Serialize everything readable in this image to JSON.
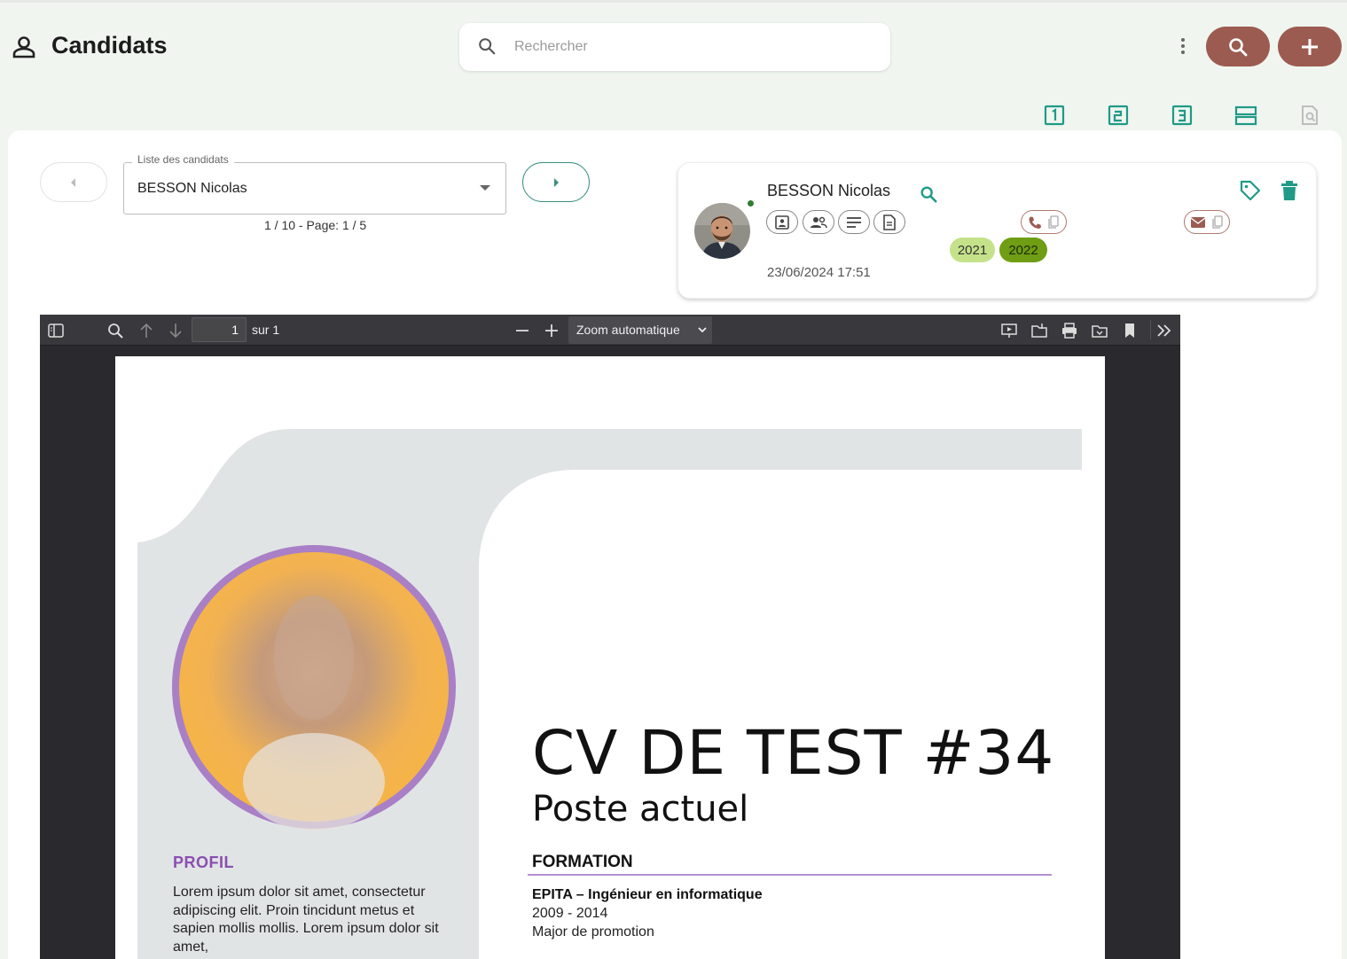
{
  "header": {
    "title": "Candidats",
    "search_placeholder": "Rechercher",
    "search_value": ""
  },
  "view_icons": [
    "view-1-icon",
    "view-2-icon",
    "view-3-icon",
    "split-view-icon",
    "document-search-icon"
  ],
  "selector": {
    "legend": "Liste des candidats",
    "selected": "BESSON Nicolas",
    "pager": "1 / 10 - Page: 1 / 5"
  },
  "candidate": {
    "name": "BESSON Nicolas",
    "date": "23/06/2024 17:51",
    "years": [
      "2021",
      "2022"
    ],
    "online": true
  },
  "pdf_viewer": {
    "page_number": "1",
    "page_of": "sur 1",
    "zoom": "Zoom automatique"
  },
  "cv": {
    "title": "CV DE TEST #34",
    "subtitle": "Poste actuel",
    "formation_heading": "FORMATION",
    "school": "EPITA – Ingénieur en informatique",
    "years": "2009 - 2014",
    "note": "Major de promotion",
    "profil_heading": "PROFIL",
    "profil_text": "Lorem ipsum dolor sit amet, consectetur adipiscing elit. Proin tincidunt metus et sapien mollis mollis. Lorem ipsum dolor sit amet,"
  },
  "colors": {
    "background": "#f0f5ef",
    "brand_button": "#9c5b51",
    "accent_teal": "#1f9a86",
    "year_2021": "#c5e28a",
    "year_2022": "#6f9d14",
    "cv_purple": "#8a4fb1"
  }
}
